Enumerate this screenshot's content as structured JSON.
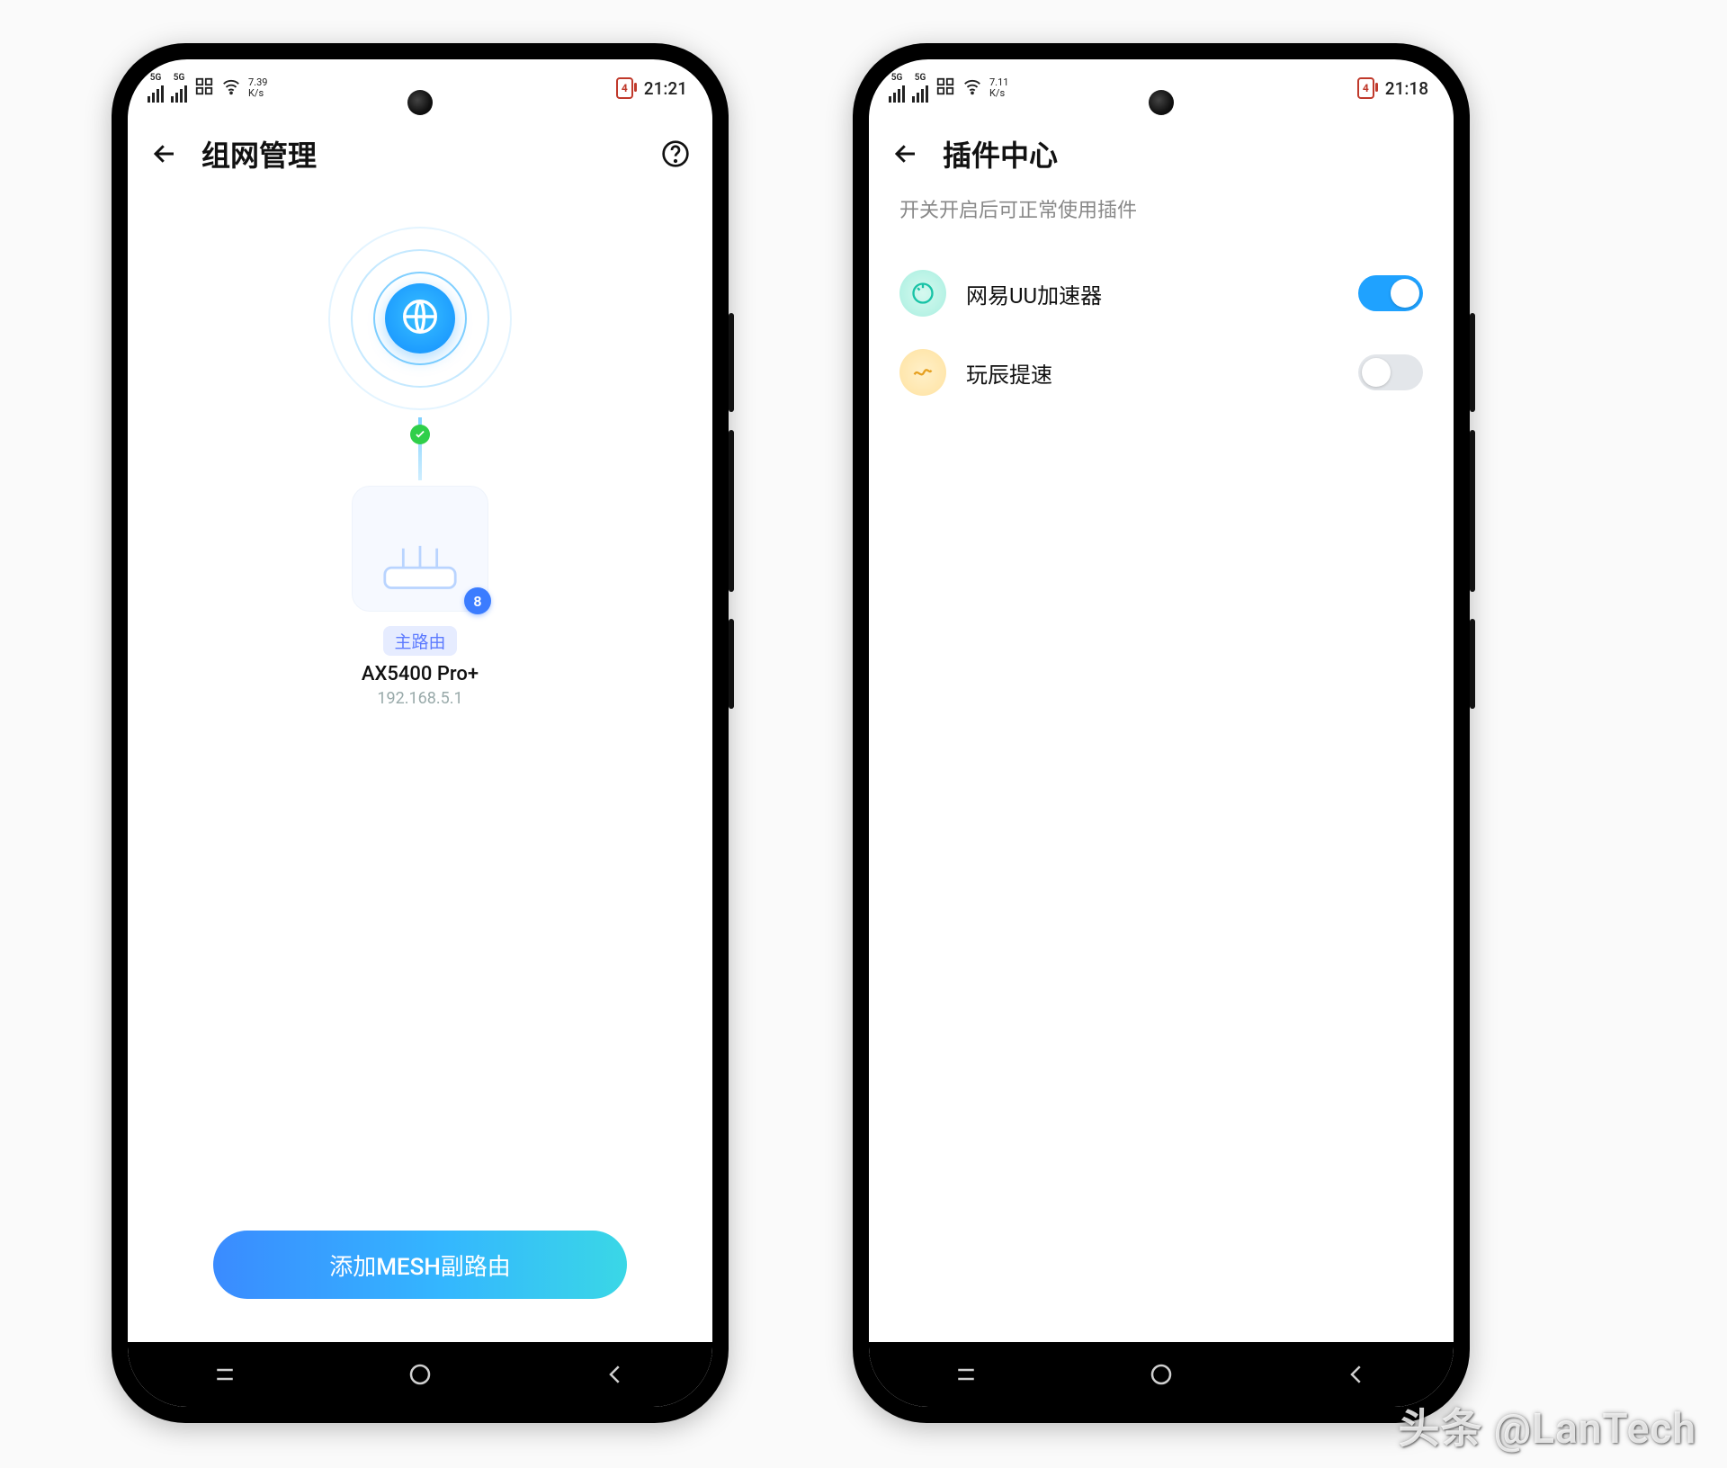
{
  "left": {
    "status": {
      "speed_top": "7.39",
      "speed_unit": "K/s",
      "battery": "4",
      "time": "21:21"
    },
    "title": "组网管理",
    "router": {
      "tag": "主路由",
      "name": "AX5400 Pro+",
      "ip": "192.168.5.1",
      "badge": "8"
    },
    "cta": "添加MESH副路由"
  },
  "right": {
    "status": {
      "speed_top": "7.11",
      "speed_unit": "K/s",
      "battery": "4",
      "time": "21:18"
    },
    "title": "插件中心",
    "subtitle": "开关开启后可正常使用插件",
    "plugins": [
      {
        "name": "网易UU加速器",
        "on": true
      },
      {
        "name": "玩辰提速",
        "on": false
      }
    ]
  },
  "watermark": "头条 @LanTech"
}
